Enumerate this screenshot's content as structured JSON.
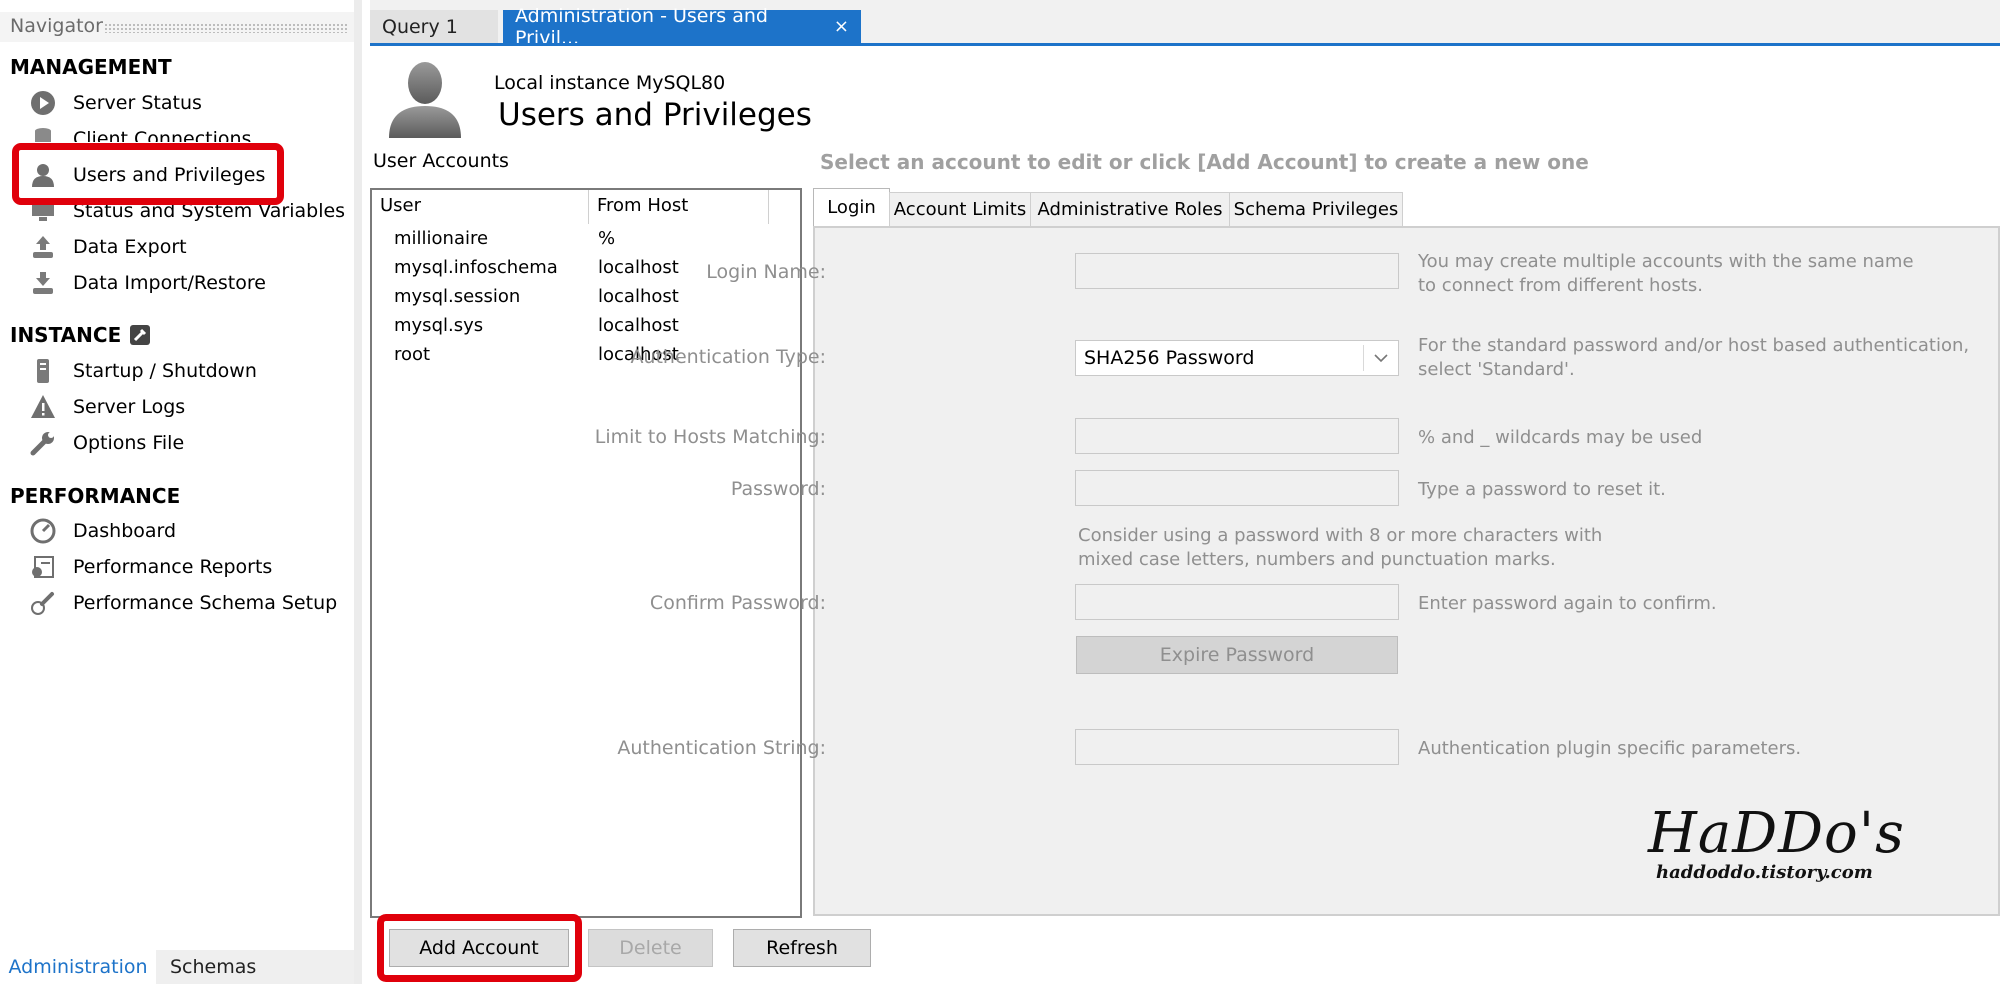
{
  "navigator": {
    "title": "Navigator",
    "sections": {
      "management": "MANAGEMENT",
      "instance": "INSTANCE",
      "performance": "PERFORMANCE"
    },
    "management_items": {
      "server_status": "Server Status",
      "client_connections": "Client Connections",
      "users_privileges": "Users and Privileges",
      "status_variables": "Status and System Variables",
      "data_export": "Data Export",
      "data_import": "Data Import/Restore"
    },
    "instance_items": {
      "startup": "Startup / Shutdown",
      "server_logs": "Server Logs",
      "options_file": "Options File"
    },
    "performance_items": {
      "dashboard": "Dashboard",
      "perf_reports": "Performance Reports",
      "perf_schema": "Performance Schema Setup"
    },
    "bottom_tabs": {
      "administration": "Administration",
      "schemas": "Schemas"
    }
  },
  "tabs": {
    "query": "Query 1",
    "admin": "Administration - Users and Privil...",
    "close": "×"
  },
  "header": {
    "subtitle": "Local instance MySQL80",
    "title": "Users and Privileges"
  },
  "user_accounts": {
    "label": "User Accounts",
    "col_user": "User",
    "col_host": "From Host",
    "rows": [
      {
        "user": "millionaire",
        "host": "%"
      },
      {
        "user": "mysql.infoschema",
        "host": "localhost"
      },
      {
        "user": "mysql.session",
        "host": "localhost"
      },
      {
        "user": "mysql.sys",
        "host": "localhost"
      },
      {
        "user": "root",
        "host": "localhost"
      }
    ]
  },
  "detail": {
    "message": "Select an account to edit or click [Add Account] to create a new one",
    "tabs": {
      "login": "Login",
      "account_limits": "Account Limits",
      "admin_roles": "Administrative Roles",
      "schema_privileges": "Schema Privileges"
    },
    "login_name": {
      "label": "Login Name:",
      "hint1": "You may create multiple accounts with the same name",
      "hint2": "to connect from different hosts."
    },
    "auth_type": {
      "label": "Authentication Type:",
      "value": "SHA256 Password",
      "hint1": "For the standard password and/or host based authentication,",
      "hint2": "select 'Standard'."
    },
    "hosts": {
      "label": "Limit to Hosts Matching:",
      "hint": "% and _ wildcards may be used"
    },
    "password": {
      "label": "Password:",
      "hint": "Type a password to reset it.",
      "note1": "Consider using a password with 8 or more characters with",
      "note2": "mixed case letters, numbers and punctuation marks."
    },
    "confirm": {
      "label": "Confirm Password:",
      "hint": "Enter password again to confirm."
    },
    "expire_button": "Expire Password",
    "auth_string": {
      "label": "Authentication String:",
      "hint": "Authentication plugin specific parameters."
    }
  },
  "buttons": {
    "add": "Add Account",
    "delete": "Delete",
    "refresh": "Refresh"
  },
  "watermark": {
    "name": "HaDDo's",
    "url": "haddoddo.tistory.com"
  },
  "colors": {
    "accent_blue": "#1d73c9",
    "highlight_red": "#e0000b"
  }
}
